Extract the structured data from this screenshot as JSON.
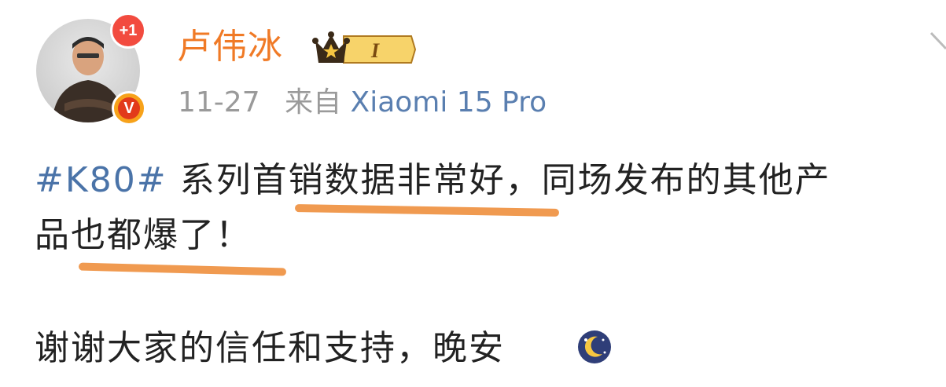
{
  "user": {
    "name": "卢伟冰",
    "notification_count": "+1",
    "verified_mark": "V",
    "vip_level": "I"
  },
  "post_meta": {
    "date": "11-27",
    "from_label": "来自",
    "source": "Xiaomi 15 Pro"
  },
  "post": {
    "hashtag": "#K80#",
    "line1_text": "系列首销数据非常好，同场发布的其他产",
    "line2_text": "品也都爆了！",
    "line3_text": "谢谢大家的信任和支持，晚安"
  },
  "icons": {
    "vip": "crown-vip-icon",
    "moon": "moon-emoji-icon",
    "corner": "chevron-icon"
  },
  "colors": {
    "username": "#f07a26",
    "hashtag": "#4a73a8",
    "source": "#5a7fb0",
    "highlight": "#f09a50"
  }
}
